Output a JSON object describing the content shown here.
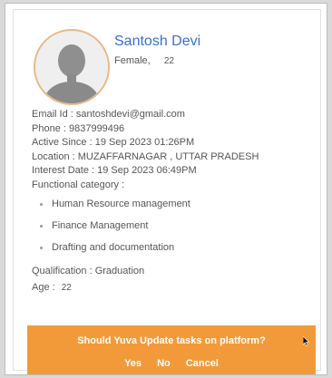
{
  "profile": {
    "name": "Santosh Devi",
    "gender": "Female,",
    "age": "22"
  },
  "details": {
    "email": "Email Id : santoshdevi@gmail.com",
    "phone": "Phone : 9837999496",
    "active_since": "Active Since : 19 Sep 2023 01:26PM",
    "location": "Location : MUZAFFARNAGAR , UTTAR PRADESH",
    "interest_date": "Interest Date : 19 Sep 2023 06:49PM",
    "functional_category_label": "Functional category :",
    "functional_categories": [
      "Human Resource management",
      "Finance Management",
      "Drafting and documentation"
    ],
    "qualification": "Qualification : Graduation",
    "age_label": "Age :",
    "age_value": "22"
  },
  "prompt": {
    "question": "Should Yuva Update tasks on platform?",
    "yes": "Yes",
    "no": "No",
    "cancel": "Cancel"
  },
  "colors": {
    "accent": "#3a6fd1",
    "banner": "#f29a3a",
    "avatar_ring": "#e6b98a"
  },
  "icons": {
    "avatar": "person-silhouette-icon",
    "cursor": "mouse-pointer-icon"
  }
}
